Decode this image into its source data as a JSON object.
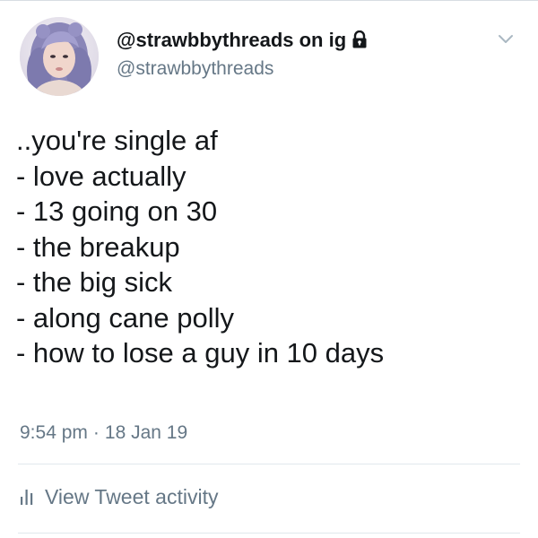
{
  "author": {
    "display_name": "@strawbbythreads on ig",
    "handle": "@strawbbythreads",
    "protected_icon": "lock-icon",
    "avatar_icon": "profile-photo"
  },
  "tweet": {
    "lines": [
      "..you're single af",
      "- love actually",
      "- 13 going on 30",
      "- the breakup",
      "- the big sick",
      "- along cane polly",
      "- how to lose a guy in 10 days"
    ],
    "time": "9:54 pm",
    "separator": "·",
    "date": "18 Jan 19"
  },
  "activity": {
    "label": "View Tweet activity",
    "icon": "bar-chart-icon"
  },
  "menu": {
    "icon": "chevron-down-icon"
  },
  "colors": {
    "text": "#14171a",
    "secondary": "#657786",
    "divider": "#e1e8ed"
  }
}
